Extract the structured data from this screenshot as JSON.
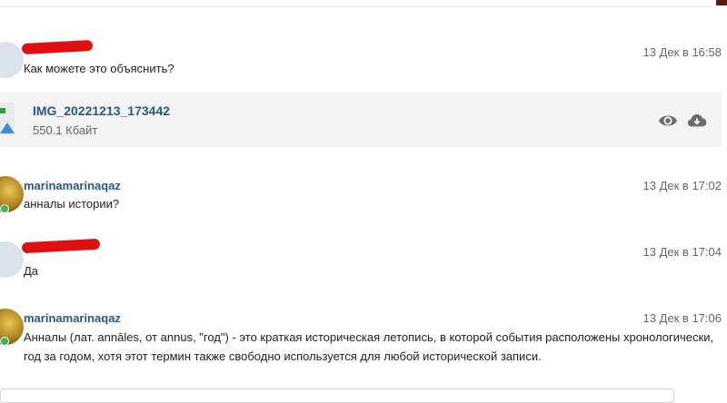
{
  "messages": [
    {
      "author": "",
      "author_redacted": true,
      "time": "13 Дек в 16:58",
      "text": "Как можете это объяснить?",
      "online": false,
      "avatar": "default-avatar"
    },
    {
      "author": "marinamarinaqaz",
      "author_redacted": false,
      "time": "13 Дек в 17:02",
      "text": "анналы истории?",
      "online": true,
      "avatar": "photo-avatar"
    },
    {
      "author": "",
      "author_redacted": true,
      "time": "13 Дек в 17:04",
      "text": "Да",
      "online": false,
      "avatar": "default-avatar"
    },
    {
      "author": "marinamarinaqaz",
      "author_redacted": false,
      "time": "13 Дек в 17:06",
      "text": "Анналы (лат. annāles, от annus, \"год\") - это краткая историческая летопись, в которой события расположены хронологически, год за годом, хотя этот термин также свободно используется для любой исторической записи.",
      "online": true,
      "avatar": "photo-avatar"
    }
  ],
  "attachment": {
    "name": "IMG_20221213_173442",
    "size": "550.1 Кбайт",
    "icons": [
      "image-file-icon",
      "eye-icon",
      "cloud-download-icon"
    ]
  },
  "colors": {
    "link": "#2a5885",
    "redaction": "#e11010",
    "online": "#4caf50",
    "attachment_bg": "#f4f4f5"
  }
}
